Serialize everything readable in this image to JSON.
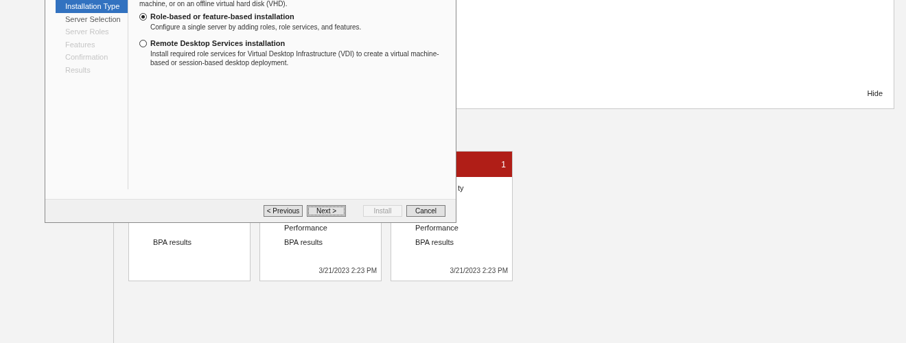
{
  "dashboard": {
    "hide_link": "Hide",
    "tiles": [
      {
        "rows": [
          {
            "kind": "line",
            "text": "BPA results"
          }
        ]
      },
      {
        "rows": [
          {
            "kind": "line",
            "text": "Performance"
          },
          {
            "kind": "line",
            "text": "BPA results"
          }
        ],
        "timestamp": "3/21/2023 2:23 PM"
      },
      {
        "alert": true,
        "count": "1",
        "rows": [
          {
            "kind": "fragment",
            "text": "ty"
          },
          {
            "kind": "line",
            "text": "Performance"
          },
          {
            "kind": "line",
            "text": "BPA results"
          }
        ],
        "timestamp": "3/21/2023 2:23 PM"
      }
    ]
  },
  "wizard": {
    "nav": [
      {
        "label": "Installation Type",
        "selected": true,
        "disabled": false
      },
      {
        "label": "Server Selection",
        "selected": false,
        "disabled": false
      },
      {
        "label": "Server Roles",
        "selected": false,
        "disabled": true
      },
      {
        "label": "Features",
        "selected": false,
        "disabled": true
      },
      {
        "label": "Confirmation",
        "selected": false,
        "disabled": true
      },
      {
        "label": "Results",
        "selected": false,
        "disabled": true
      }
    ],
    "intro": "machine, or on an offline virtual hard disk (VHD).",
    "options": [
      {
        "label": "Role-based or feature-based installation",
        "description": "Configure a single server by adding roles, role services, and features.",
        "selected": true
      },
      {
        "label": "Remote Desktop Services installation",
        "description": "Install required role services for Virtual Desktop Infrastructure (VDI) to create a virtual machine-based or session-based desktop deployment.",
        "selected": false
      }
    ],
    "buttons": [
      {
        "label": "< Previous",
        "disabled": false,
        "focused": false
      },
      {
        "label": "Next >",
        "disabled": false,
        "focused": true
      },
      {
        "label": "Install",
        "disabled": true,
        "focused": false
      },
      {
        "label": "Cancel",
        "disabled": false,
        "focused": false
      }
    ]
  }
}
